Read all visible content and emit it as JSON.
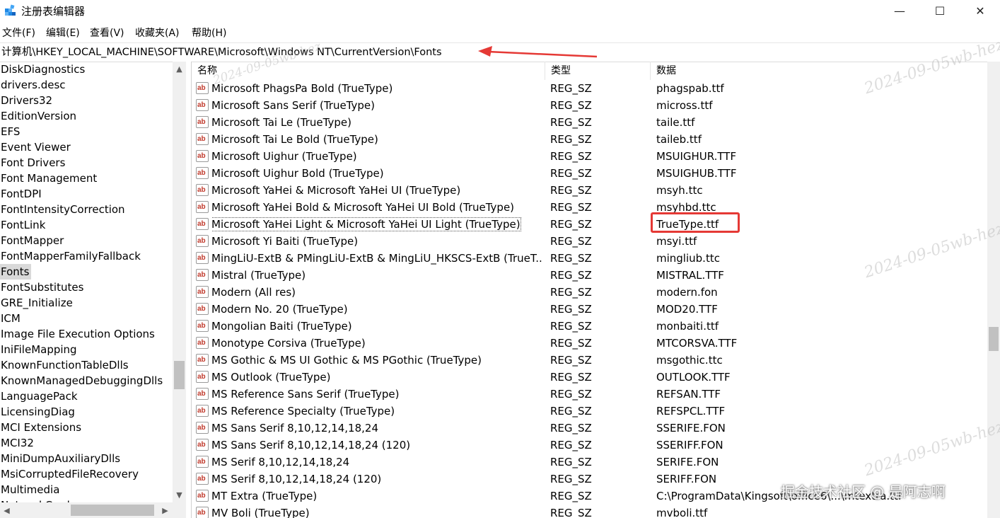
{
  "window": {
    "title": "注册表编辑器",
    "controls": {
      "minimize": "—",
      "maximize": "☐",
      "close": "✕"
    }
  },
  "menu": [
    "文件(F)",
    "编辑(E)",
    "查看(V)",
    "收藏夹(A)",
    "帮助(H)"
  ],
  "address": "计算机\\HKEY_LOCAL_MACHINE\\SOFTWARE\\Microsoft\\Windows NT\\CurrentVersion\\Fonts",
  "tree": {
    "items": [
      "DiskDiagnostics",
      "drivers.desc",
      "Drivers32",
      "EditionVersion",
      "EFS",
      "Event Viewer",
      "Font Drivers",
      "Font Management",
      "FontDPI",
      "FontIntensityCorrection",
      "FontLink",
      "FontMapper",
      "FontMapperFamilyFallback",
      "Fonts",
      "FontSubstitutes",
      "GRE_Initialize",
      "ICM",
      "Image File Execution Options",
      "IniFileMapping",
      "KnownFunctionTableDlls",
      "KnownManagedDebuggingDlls",
      "LanguagePack",
      "LicensingDiag",
      "MCI Extensions",
      "MCI32",
      "MiniDumpAuxiliaryDlls",
      "MsiCorruptedFileRecovery",
      "Multimedia",
      "NetworkCards"
    ],
    "selected": "Fonts"
  },
  "list": {
    "columns": {
      "name": "名称",
      "type": "类型",
      "data": "数据"
    },
    "rows": [
      {
        "name": "Microsoft PhagsPa Bold (TrueType)",
        "type": "REG_SZ",
        "data": "phagspab.ttf"
      },
      {
        "name": "Microsoft Sans Serif (TrueType)",
        "type": "REG_SZ",
        "data": "micross.ttf"
      },
      {
        "name": "Microsoft Tai Le (TrueType)",
        "type": "REG_SZ",
        "data": "taile.ttf"
      },
      {
        "name": "Microsoft Tai Le Bold (TrueType)",
        "type": "REG_SZ",
        "data": "taileb.ttf"
      },
      {
        "name": "Microsoft Uighur (TrueType)",
        "type": "REG_SZ",
        "data": "MSUIGHUR.TTF"
      },
      {
        "name": "Microsoft Uighur Bold (TrueType)",
        "type": "REG_SZ",
        "data": "MSUIGHUB.TTF"
      },
      {
        "name": "Microsoft YaHei & Microsoft YaHei UI (TrueType)",
        "type": "REG_SZ",
        "data": "msyh.ttc"
      },
      {
        "name": "Microsoft YaHei Bold & Microsoft YaHei UI Bold (TrueType)",
        "type": "REG_SZ",
        "data": "msyhbd.ttc"
      },
      {
        "name": "Microsoft YaHei Light & Microsoft YaHei UI Light (TrueType)",
        "type": "REG_SZ",
        "data": "TrueType.ttf"
      },
      {
        "name": "Microsoft Yi Baiti (TrueType)",
        "type": "REG_SZ",
        "data": "msyi.ttf"
      },
      {
        "name": "MingLiU-ExtB & PMingLiU-ExtB & MingLiU_HKSCS-ExtB (TrueT...",
        "type": "REG_SZ",
        "data": "mingliub.ttc"
      },
      {
        "name": "Mistral (TrueType)",
        "type": "REG_SZ",
        "data": "MISTRAL.TTF"
      },
      {
        "name": "Modern (All res)",
        "type": "REG_SZ",
        "data": "modern.fon"
      },
      {
        "name": "Modern No. 20 (TrueType)",
        "type": "REG_SZ",
        "data": "MOD20.TTF"
      },
      {
        "name": "Mongolian Baiti (TrueType)",
        "type": "REG_SZ",
        "data": "monbaiti.ttf"
      },
      {
        "name": "Monotype Corsiva (TrueType)",
        "type": "REG_SZ",
        "data": "MTCORSVA.TTF"
      },
      {
        "name": "MS Gothic & MS UI Gothic & MS PGothic (TrueType)",
        "type": "REG_SZ",
        "data": "msgothic.ttc"
      },
      {
        "name": "MS Outlook (TrueType)",
        "type": "REG_SZ",
        "data": "OUTLOOK.TTF"
      },
      {
        "name": "MS Reference Sans Serif (TrueType)",
        "type": "REG_SZ",
        "data": "REFSAN.TTF"
      },
      {
        "name": "MS Reference Specialty (TrueType)",
        "type": "REG_SZ",
        "data": "REFSPCL.TTF"
      },
      {
        "name": "MS Sans Serif 8,10,12,14,18,24",
        "type": "REG_SZ",
        "data": "SSERIFE.FON"
      },
      {
        "name": "MS Sans Serif 8,10,12,14,18,24 (120)",
        "type": "REG_SZ",
        "data": "SSERIFF.FON"
      },
      {
        "name": "MS Serif 8,10,12,14,18,24",
        "type": "REG_SZ",
        "data": "SERIFE.FON"
      },
      {
        "name": "MS Serif 8,10,12,14,18,24 (120)",
        "type": "REG_SZ",
        "data": "SERIFF.FON"
      },
      {
        "name": "MT Extra (TrueType)",
        "type": "REG_SZ",
        "data": "C:\\ProgramData\\Kingsoft\\office6\\...\\mtextra.ttf"
      },
      {
        "name": "MV Boli (TrueType)",
        "type": "REG_SZ",
        "data": "mvboli.ttf"
      }
    ],
    "focused_row": 8,
    "highlighted_row": 8,
    "icon_text": "ab"
  },
  "watermarks": [
    "2024-09-05wb-hez",
    "2024-09-05wb-hez",
    "2024-09-05wb-hez",
    "2024-09-05wb-hez"
  ],
  "brand_watermark": "掘金技术社区 @ 是阿志啊",
  "colors": {
    "annotation_red": "#e53935",
    "selected_bg": "#d9d9d9"
  }
}
